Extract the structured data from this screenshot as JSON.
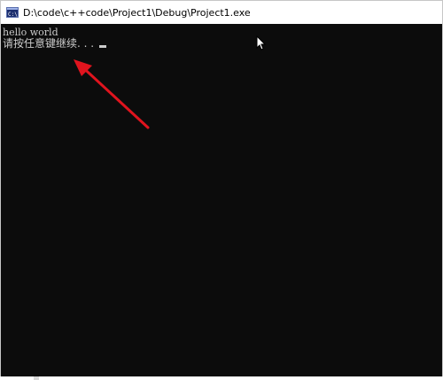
{
  "window": {
    "title": "D:\\code\\c++code\\Project1\\Debug\\Project1.exe",
    "title_icon": "console-app-icon"
  },
  "console": {
    "lines": [
      "hello world",
      "请按任意键继续. . ."
    ],
    "background_color": "#0c0c0c",
    "text_color": "#cccccc"
  },
  "annotation": {
    "arrow_color": "#e0141e",
    "arrow_icon": "red-arrow-annotation"
  },
  "pointer": {
    "icon": "mouse-pointer-icon"
  }
}
